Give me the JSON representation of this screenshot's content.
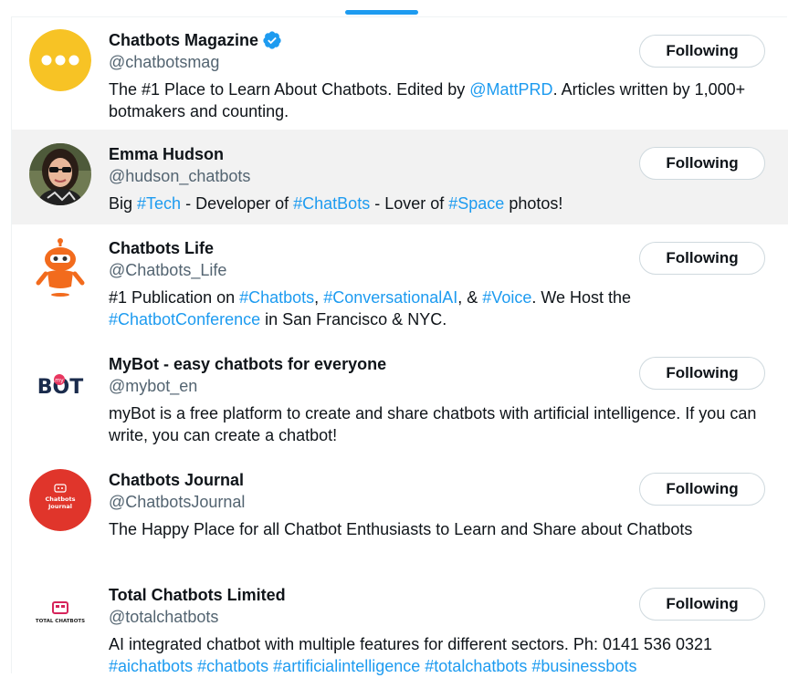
{
  "colors": {
    "accent": "#1d9bf0",
    "text": "#0f1419",
    "secondary": "#536471",
    "highlight": "#f2f2f2"
  },
  "accounts": [
    {
      "name": "Chatbots Magazine",
      "handle": "@chatbotsmag",
      "verified": true,
      "button_label": "Following",
      "avatar_icon": "chat-bubble-dots-icon",
      "bio": [
        {
          "text": "The #1 Place to Learn About Chatbots. Edited by ",
          "link": false
        },
        {
          "text": "@MattPRD",
          "link": true
        },
        {
          "text": ". Articles written by 1,000+ botmakers and counting.",
          "link": false
        }
      ]
    },
    {
      "name": "Emma Hudson",
      "handle": "@hudson_chatbots",
      "verified": false,
      "button_label": "Following",
      "avatar_icon": "profile-photo",
      "bio": [
        {
          "text": "Big ",
          "link": false
        },
        {
          "text": "#Tech",
          "link": true
        },
        {
          "text": " - Developer of ",
          "link": false
        },
        {
          "text": "#ChatBots",
          "link": true
        },
        {
          "text": " - Lover of ",
          "link": false
        },
        {
          "text": "#Space",
          "link": true
        },
        {
          "text": " photos!",
          "link": false
        }
      ]
    },
    {
      "name": "Chatbots Life",
      "handle": "@Chatbots_Life",
      "verified": false,
      "button_label": "Following",
      "avatar_icon": "robot-icon",
      "bio": [
        {
          "text": "#1 Publication on ",
          "link": false
        },
        {
          "text": "#Chatbots",
          "link": true
        },
        {
          "text": ", ",
          "link": false
        },
        {
          "text": "#ConversationalAI",
          "link": true
        },
        {
          "text": ", & ",
          "link": false
        },
        {
          "text": "#Voice",
          "link": true
        },
        {
          "text": ". We Host the ",
          "link": false
        },
        {
          "text": "#ChatbotConference",
          "link": true
        },
        {
          "text": " in San Francisco & NYC.",
          "link": false
        }
      ]
    },
    {
      "name": "MyBot - easy chatbots for everyone",
      "handle": "@mybot_en",
      "verified": false,
      "button_label": "Following",
      "avatar_icon": "mybot-logo",
      "logo_text": "BOT",
      "logo_small": "my",
      "bio": [
        {
          "text": "myBot is a free platform to create and share chatbots with artificial intelligence. If you can write, you can create a chatbot!",
          "link": false
        }
      ]
    },
    {
      "name": "Chatbots Journal",
      "handle": "@ChatbotsJournal",
      "verified": false,
      "button_label": "Following",
      "avatar_icon": "chatbots-journal-logo",
      "logo_text": "Chatbots Journal",
      "bio": [
        {
          "text": "The Happy Place for all Chatbot Enthusiasts to Learn and Share about Chatbots",
          "link": false
        }
      ]
    },
    {
      "name": "Total Chatbots Limited",
      "handle": "@totalchatbots",
      "verified": false,
      "button_label": "Following",
      "avatar_icon": "total-chatbots-logo",
      "logo_text": "TOTAL CHATBOTS",
      "bio": [
        {
          "text": "AI integrated chatbot with multiple features for different sectors. Ph: 0141 536 0321 ",
          "link": false
        },
        {
          "text": "#aichatbots",
          "link": true
        },
        {
          "text": " ",
          "link": false
        },
        {
          "text": "#chatbots",
          "link": true
        },
        {
          "text": " ",
          "link": false
        },
        {
          "text": "#artificialintelligence",
          "link": true
        },
        {
          "text": " ",
          "link": false
        },
        {
          "text": "#totalchatbots",
          "link": true
        },
        {
          "text": " ",
          "link": false
        },
        {
          "text": "#businessbots",
          "link": true
        }
      ]
    }
  ]
}
